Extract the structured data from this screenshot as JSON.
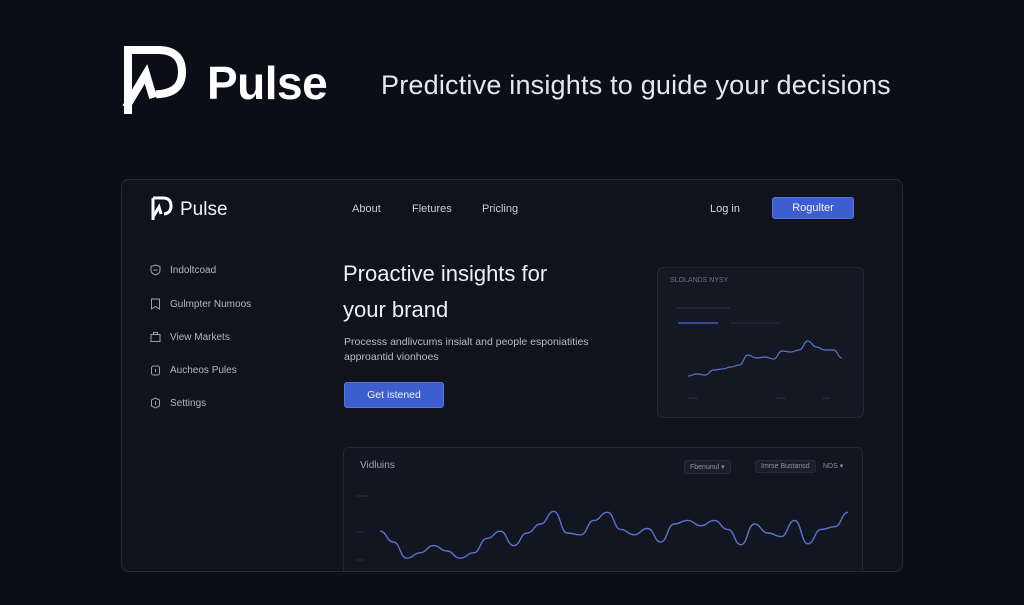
{
  "brand": {
    "name": "Pulse",
    "tagline": "Predictive insights to guide your decisions"
  },
  "app": {
    "name": "Pulse",
    "nav": [
      "About",
      "Fletures",
      "Pricling"
    ],
    "login_label": "Log in",
    "register_label": "Rogulter",
    "accent": "#3d5ecf"
  },
  "sidebar": {
    "items": [
      {
        "label": "Indoltcoad",
        "icon": "shield-icon"
      },
      {
        "label": "Gulmpter Numoos",
        "icon": "bookmark-icon"
      },
      {
        "label": "View Markets",
        "icon": "briefcase-icon"
      },
      {
        "label": "Aucheos Pules",
        "icon": "lock-icon"
      },
      {
        "label": "Settings",
        "icon": "badge-icon"
      }
    ]
  },
  "hero": {
    "title_line1": "Proactive insights for",
    "title_line2": "your brand",
    "desc_line1": "Processs andlivcums insialt and people esponiatities",
    "desc_line2": "approantid vionhoes",
    "cta_label": "Get istened"
  },
  "mini_card": {
    "title": "SLOLANDS NYSY",
    "chart_data": {
      "type": "line",
      "title": "",
      "xlabel": "",
      "ylabel": "",
      "series": [
        {
          "values": [
            12,
            14,
            13,
            18,
            19,
            21,
            23,
            33,
            30,
            31,
            29,
            37,
            36,
            38,
            47,
            41,
            38,
            38,
            30
          ]
        }
      ],
      "ylim": [
        0,
        60
      ],
      "grid": false
    }
  },
  "big_card": {
    "title": "Vidluins",
    "dropdown_label": "Fbenunul",
    "filter_label": "Imrse Bustansd",
    "range_label": "NDS"
  },
  "chart_data": {
    "type": "line",
    "title": "",
    "xlabel": "",
    "ylabel": "",
    "series": [
      {
        "values": [
          52,
          40,
          22,
          28,
          36,
          30,
          22,
          28,
          44,
          52,
          36,
          50,
          60,
          74,
          50,
          48,
          64,
          73,
          54,
          48,
          55,
          40,
          60,
          64,
          58,
          64,
          54,
          37,
          60,
          50,
          46,
          64,
          38,
          54,
          57,
          73
        ]
      }
    ],
    "ylim": [
      0,
      100
    ],
    "grid": false,
    "color": "#5a73d0"
  }
}
